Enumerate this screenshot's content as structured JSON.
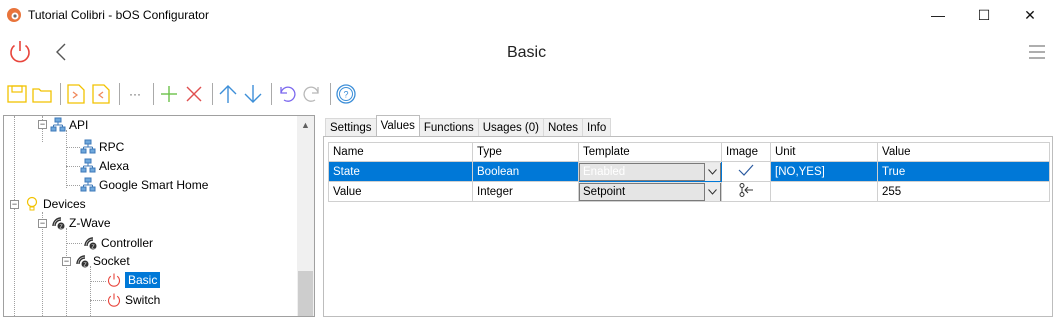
{
  "window": {
    "title": "Tutorial Colibri - bOS Configurator",
    "minimize": "—",
    "maximize": "☐",
    "close": "✕"
  },
  "header": {
    "title": "Basic"
  },
  "toolbar": {
    "more_label": "···"
  },
  "tree": {
    "items": {
      "api": "API",
      "rpc": "RPC",
      "alexa": "Alexa",
      "google": "Google Smart Home",
      "devices": "Devices",
      "zwave": "Z-Wave",
      "controller": "Controller",
      "socket": "Socket",
      "basic": "Basic",
      "switch": "Switch"
    }
  },
  "tabs": [
    "Settings",
    "Values",
    "Functions",
    "Usages (0)",
    "Notes",
    "Info"
  ],
  "grid": {
    "columns": [
      "Name",
      "Type",
      "Template",
      "Image",
      "Unit",
      "Value"
    ],
    "rows": [
      {
        "name": "State",
        "type": "Boolean",
        "template": "Enabled",
        "image": "checkmark-icon",
        "unit": "[NO,YES]",
        "value": "True"
      },
      {
        "name": "Value",
        "type": "Integer",
        "template": "Setpoint",
        "image": "setpoint-icon",
        "unit": "",
        "value": "255"
      }
    ]
  },
  "colors": {
    "accent": "#0078d7",
    "power": "#e8453c",
    "toolbar_yellow": "#f2c200",
    "toolbar_orange": "#f08a5d",
    "toolbar_green": "#6cc24a",
    "toolbar_red": "#e05050",
    "toolbar_blue": "#3d8fd8",
    "toolbar_purple": "#7b68ee"
  }
}
